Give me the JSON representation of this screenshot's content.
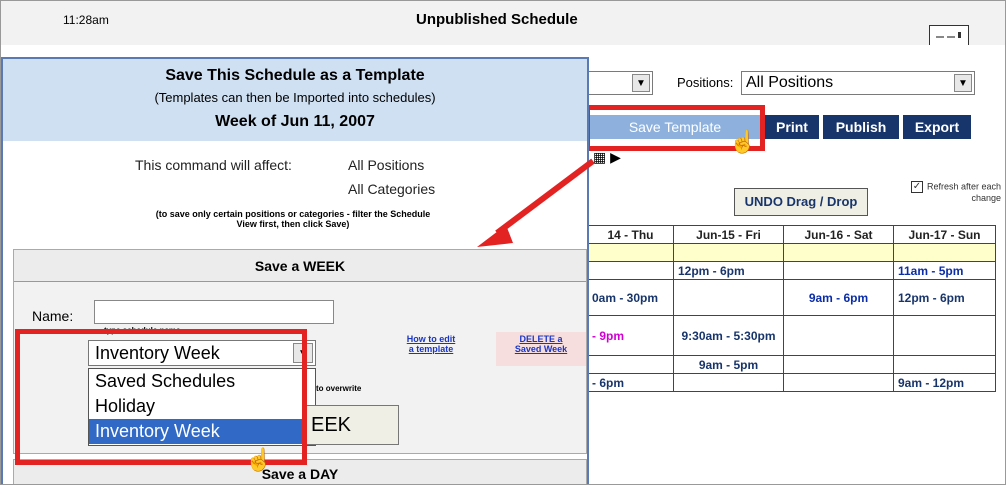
{
  "header": {
    "time": "11:28am",
    "title": "Unpublished Schedule"
  },
  "toolbar": {
    "positions_label": "Positions:",
    "positions_value": "All Positions",
    "buttons": [
      "Save Template",
      "Print",
      "Publish",
      "Export"
    ],
    "undo_label": "UNDO Drag / Drop",
    "refresh_label": "Refresh after each change"
  },
  "grid": {
    "days": [
      "14 - Thu",
      "Jun-15 - Fri",
      "Jun-16 - Sat",
      "Jun-17 - Sun"
    ],
    "rows": [
      [
        "",
        "12pm - 6pm",
        "",
        "11am - 5pm"
      ],
      [
        "0am - 30pm",
        "",
        "9am - 6pm",
        "12pm - 6pm"
      ],
      [
        "- 9pm",
        "9:30am - 5:30pm",
        "",
        ""
      ],
      [
        "",
        "9am - 5pm",
        "",
        ""
      ],
      [
        "- 6pm",
        "",
        "",
        "9am - 12pm"
      ]
    ]
  },
  "dialog": {
    "title": "Save This Schedule as a Template",
    "subtitle": "(Templates can then be Imported into schedules)",
    "week_of": "Week of Jun 11, 2007",
    "affect_label": "This command will affect:",
    "affect_positions": "All Positions",
    "affect_categories": "All Categories",
    "note": "(to save only certain positions or categories - filter the Schedule View first, then click Save)",
    "save_week_header": "Save a WEEK",
    "name_label": "Name:",
    "name_value": "",
    "name_hint": "type schedule name",
    "selected_template": "Inventory Week",
    "dropdown_options": [
      "Saved Schedules",
      "Holiday",
      "Inventory Week"
    ],
    "overwrite_hint": "to overwrite",
    "week_button": "EEK",
    "how_to_edit": "How to edit a template",
    "delete_week": "DELETE a Saved Week",
    "save_day_header": "Save a DAY"
  },
  "colors": {
    "navy_button": "#18356b",
    "highlight_blue": "#3169c6",
    "callout_red": "#e32222",
    "header_blue": "#cfe0f3"
  }
}
